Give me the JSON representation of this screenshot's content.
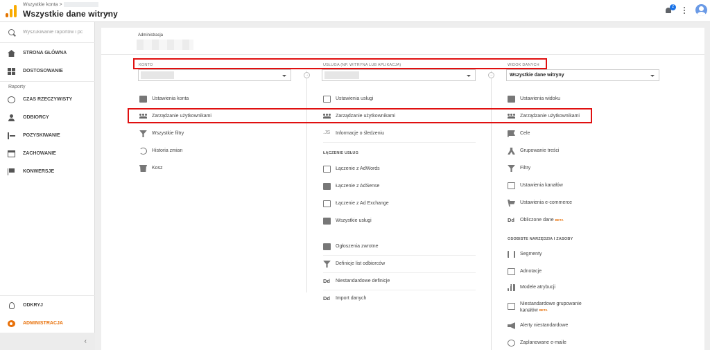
{
  "header": {
    "breadcrumb": "Wszystkie konta >",
    "view_title": "Wszystkie dane witryny",
    "notification_count": "2"
  },
  "sidebar": {
    "search_placeholder": "Wyszukiwanie raportów i pc",
    "home": "STRONA GŁÓWNA",
    "customization": "DOSTOSOWANIE",
    "reports_section": "Raporty",
    "realtime": "CZAS RZECZYWISTY",
    "audience": "ODBIORCY",
    "acquisition": "POZYSKIWANIE",
    "behavior": "ZACHOWANIE",
    "conversions": "KONWERSJE",
    "discover": "ODKRYJ",
    "admin": "ADMINISTRACJA",
    "collapse": "‹"
  },
  "main": {
    "title": "Administracja",
    "account": {
      "label": "KONTO",
      "items": [
        "Ustawienia konta",
        "Zarządzanie użytkownikami",
        "Wszystkie filtry",
        "Historia zmian",
        "Kosz"
      ]
    },
    "property": {
      "label": "USŁUGA (NP. WITRYNA LUB APLIKACJA)",
      "items": [
        "Ustawienia usługi",
        "Zarządzanie użytkownikami",
        "Informacje o śledzeniu"
      ],
      "section_linking": "ŁĄCZENIE USŁUG",
      "linking_items": [
        "Łączenie z AdWords",
        "Łączenie z AdSense",
        "Łączenie z Ad Exchange",
        "Wszystkie usługi"
      ],
      "more_items": [
        "Ogłoszenia zwrotne",
        "Definicje list odbiorców",
        "Niestandardowe definicje",
        "Import danych"
      ]
    },
    "view": {
      "label": "WIDOK DANYCH",
      "selected": "Wszystkie dane witryny",
      "items": [
        "Ustawienia widoku",
        "Zarządzanie użytkownikami",
        "Cele",
        "Grupowanie treści",
        "Filtry",
        "Ustawienia kanałów",
        "Ustawienia e-commerce",
        "Obliczone dane"
      ],
      "beta": "BETA",
      "section_personal": "OSOBISTE NARZĘDZIA I ZASOBY",
      "personal_items": [
        "Segmenty",
        "Adnotacje",
        "Modele atrybucji",
        "Niestandardowe grupowanie kanałów",
        "Alerty niestandardowe",
        "Zaplanowane e-maile"
      ],
      "beta2": "BETA"
    }
  }
}
